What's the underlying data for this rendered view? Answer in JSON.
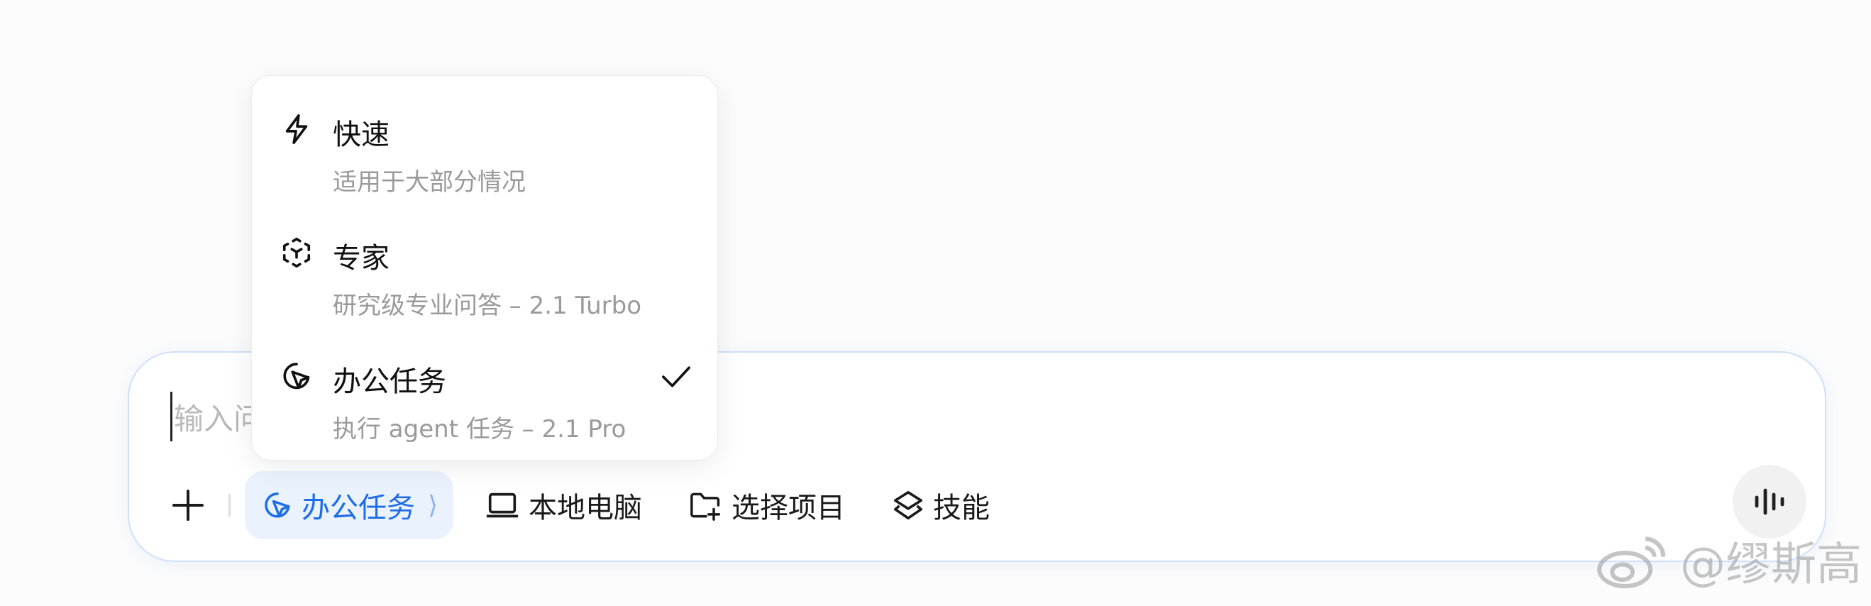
{
  "composer": {
    "placeholder_visible": "输入问"
  },
  "toolbar": {
    "mode_chip_label": "办公任务",
    "mode_chip_arrow": "⟩",
    "local_computer_label": "本地电脑",
    "select_project_label": "选择项目",
    "skills_label": "技能"
  },
  "menu": {
    "items": [
      {
        "label": "快速",
        "description": "适用于大部分情况",
        "icon": "lightning-icon",
        "selected": false
      },
      {
        "label": "专家",
        "description": "研究级专业问答 – 2.1 Turbo",
        "icon": "expert-cube-icon",
        "selected": false
      },
      {
        "label": "办公任务",
        "description": "执行 agent 任务 – 2.1 Pro",
        "icon": "cursor-click-icon",
        "selected": true
      }
    ]
  },
  "watermark": {
    "text": "@缪斯高",
    "icon": "weibo-icon"
  },
  "colors": {
    "accent": "#1d6de8",
    "chip_bg": "#eaf2fe",
    "composer_border": "#cfe0fb",
    "muted_text": "#9a9a9a"
  }
}
